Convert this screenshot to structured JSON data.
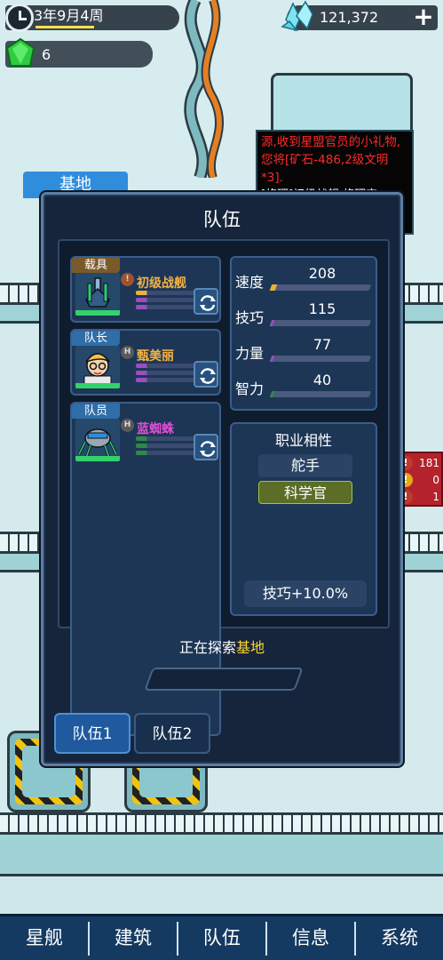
{
  "hud": {
    "date": "3年9月4周",
    "crystals": "121,372",
    "add_label": "+",
    "gems": "6"
  },
  "message": {
    "line_red": "源,收到星盟官员的小礼物,您将[矿石-486,2级文明*3].",
    "line_white": "[修理]初级战舰,修理完"
  },
  "base_tag": "基地",
  "alerts": [
    {
      "icon": "!",
      "count": "181",
      "color": "#c0392b"
    },
    {
      "icon": "!",
      "count": "0",
      "color": "#e6a817"
    },
    {
      "icon": "!",
      "count": "1",
      "color": "#c0392b"
    }
  ],
  "panel": {
    "title": "队伍",
    "slots": [
      {
        "tag": "载具",
        "tag_color": "#7a5a2b",
        "badge": "!",
        "name": "初级战舰",
        "name_color": "#f5b342",
        "bar_colors": [
          "#e8b13a",
          "#9a4ec2",
          "#9a4ec2"
        ]
      },
      {
        "tag": "队长",
        "tag_color": "#2f6ea8",
        "badge": "H",
        "name": "甄美丽",
        "name_color": "#f5b342",
        "bar_colors": [
          "#9a4ec2",
          "#9a4ec2",
          "#9a4ec2"
        ]
      },
      {
        "tag": "队员",
        "tag_color": "#2f6ea8",
        "badge": "H",
        "name": "蓝蜘蛛",
        "name_color": "#e04fd7",
        "bar_colors": [
          "#2f8a4a",
          "#2f8a4a",
          "#2f8a4a"
        ]
      }
    ],
    "stats": [
      {
        "label": "速度",
        "value": "208",
        "fill": 0.05,
        "color": "#e8b13a"
      },
      {
        "label": "技巧",
        "value": "115",
        "fill": 0.03,
        "color": "#9a4ec2"
      },
      {
        "label": "力量",
        "value": "77",
        "fill": 0.03,
        "color": "#9a4ec2"
      },
      {
        "label": "智力",
        "value": "40",
        "fill": 0.03,
        "color": "#2f8a4a"
      }
    ],
    "affinity": {
      "title": "职业相性",
      "items": [
        {
          "label": "舵手",
          "active": false
        },
        {
          "label": "科学官",
          "active": true
        }
      ],
      "bonus": "技巧+10.0%"
    },
    "explore_prefix": "正在探索",
    "explore_location": "基地",
    "tabs": [
      "队伍1",
      "队伍2"
    ],
    "active_tab": 0
  },
  "nav": [
    "星舰",
    "建筑",
    "队伍",
    "信息",
    "系统"
  ]
}
